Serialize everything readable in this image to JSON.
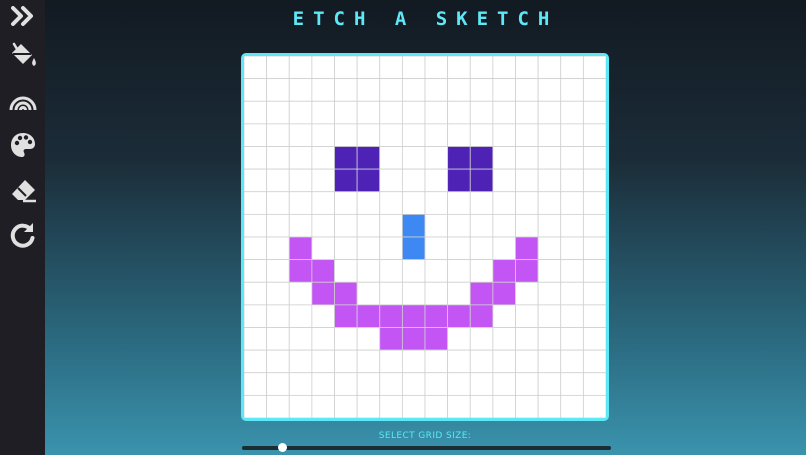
{
  "app": {
    "title": "ETCH A SKETCH"
  },
  "toolbar": {
    "tools": [
      {
        "icon": "double-chevron-right-icon"
      },
      {
        "icon": "paint-bucket-icon"
      },
      {
        "icon": "rainbow-icon"
      },
      {
        "icon": "palette-icon"
      },
      {
        "icon": "eraser-icon"
      },
      {
        "icon": "rotate-icon"
      }
    ]
  },
  "grid": {
    "size": 16,
    "line_color": "#cfcfcf",
    "background": "#ffffff",
    "painted": [
      {
        "color": "#4d22b5",
        "cells": [
          [
            4,
            4
          ],
          [
            4,
            5
          ],
          [
            5,
            4
          ],
          [
            5,
            5
          ],
          [
            4,
            9
          ],
          [
            4,
            10
          ],
          [
            5,
            9
          ],
          [
            5,
            10
          ]
        ]
      },
      {
        "color": "#3d88f2",
        "cells": [
          [
            7,
            7
          ],
          [
            8,
            7
          ]
        ]
      },
      {
        "color": "#c455f5",
        "cells": [
          [
            8,
            2
          ],
          [
            8,
            12
          ],
          [
            9,
            2
          ],
          [
            9,
            3
          ],
          [
            9,
            11
          ],
          [
            9,
            12
          ],
          [
            10,
            3
          ],
          [
            10,
            4
          ],
          [
            10,
            10
          ],
          [
            10,
            11
          ],
          [
            11,
            4
          ],
          [
            11,
            5
          ],
          [
            11,
            6
          ],
          [
            11,
            7
          ],
          [
            11,
            8
          ],
          [
            11,
            9
          ],
          [
            11,
            10
          ],
          [
            12,
            6
          ],
          [
            12,
            7
          ],
          [
            12,
            8
          ]
        ]
      }
    ]
  },
  "grid_size_control": {
    "label": "SELECT GRID SIZE:",
    "value_fraction": 0.11
  },
  "colors": {
    "accent": "#5ee7f5",
    "sidebar": "#1e1e24"
  }
}
